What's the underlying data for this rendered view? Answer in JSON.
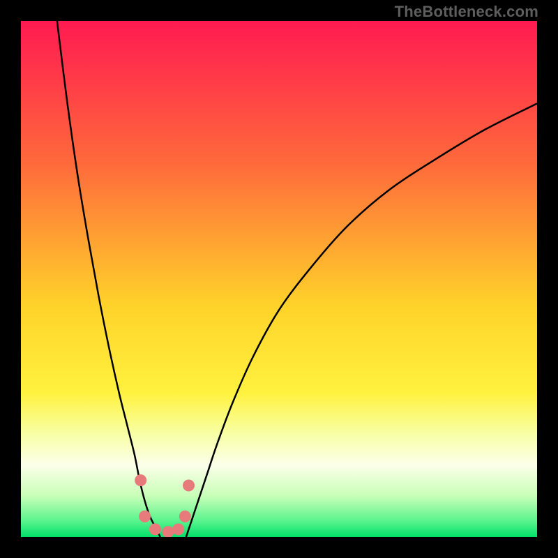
{
  "watermark": "TheBottleneck.com",
  "chart_data": {
    "type": "line",
    "title": "",
    "xlabel": "",
    "ylabel": "",
    "xlim": [
      0,
      100
    ],
    "ylim": [
      0,
      100
    ],
    "grid": false,
    "legend": false,
    "background_gradient": {
      "stops": [
        {
          "offset": 0.0,
          "color": "#ff1a51"
        },
        {
          "offset": 0.28,
          "color": "#ff6b3b"
        },
        {
          "offset": 0.55,
          "color": "#ffd22a"
        },
        {
          "offset": 0.72,
          "color": "#fff23e"
        },
        {
          "offset": 0.8,
          "color": "#f8ffa5"
        },
        {
          "offset": 0.86,
          "color": "#fcffe9"
        },
        {
          "offset": 0.92,
          "color": "#c9ffb8"
        },
        {
          "offset": 0.97,
          "color": "#57f38c"
        },
        {
          "offset": 1.0,
          "color": "#00e06b"
        }
      ]
    },
    "series": [
      {
        "name": "left-curve",
        "x": [
          7,
          9,
          11,
          13,
          15,
          17,
          19,
          20.5,
          22,
          23,
          24,
          25,
          26,
          27
        ],
        "y": [
          100,
          84,
          70,
          58,
          47,
          37,
          28,
          22,
          16,
          11,
          7,
          4,
          2,
          0
        ]
      },
      {
        "name": "right-curve",
        "x": [
          32,
          33,
          34,
          36,
          38,
          41,
          45,
          50,
          56,
          63,
          71,
          80,
          90,
          100
        ],
        "y": [
          0,
          3,
          6,
          12,
          18,
          26,
          35,
          44,
          52,
          60,
          67,
          73,
          79,
          84
        ]
      }
    ],
    "markers": {
      "name": "min-region-dots",
      "color": "#e77a7a",
      "points": [
        {
          "x": 23.2,
          "y": 11.0
        },
        {
          "x": 24.0,
          "y": 4.0
        },
        {
          "x": 26.0,
          "y": 1.5
        },
        {
          "x": 28.5,
          "y": 1.0
        },
        {
          "x": 30.5,
          "y": 1.5
        },
        {
          "x": 31.8,
          "y": 4.0
        },
        {
          "x": 32.5,
          "y": 10.0
        }
      ]
    }
  }
}
